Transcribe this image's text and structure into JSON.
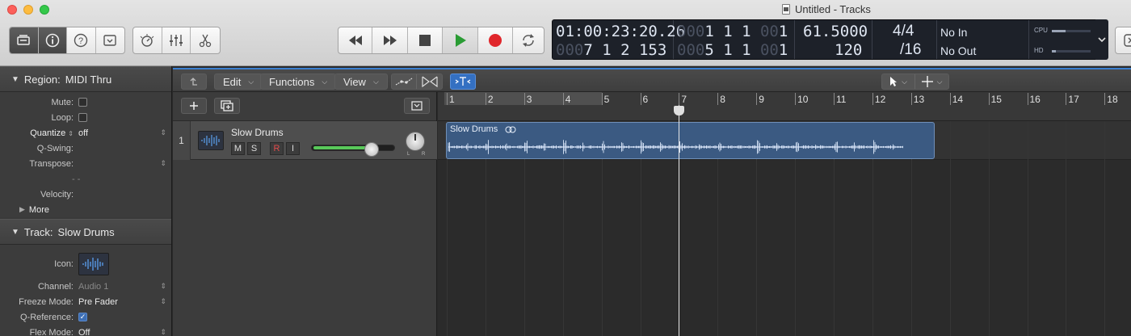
{
  "window": {
    "title": "Untitled - Tracks"
  },
  "lcd": {
    "smpte": "01:00:23:20.26",
    "bars_top_dim": "000",
    "bars_top": "1  1  1  ",
    "bars_top_dim2": "00",
    "bars_top_end": "1",
    "bars_pos_dim": "000",
    "bars_pos": "7  1  2  153",
    "bars_pos2_dim": "000",
    "bars_pos2": "5  1  1  ",
    "bars_pos2_dim2": "00",
    "bars_pos2_end": "1",
    "tempo_top": "61.5000",
    "tempo": "120",
    "sig_top": "4/4",
    "sig": "/16",
    "midi_in": "No In",
    "midi_out": "No Out",
    "cpu_label": "CPU",
    "hd_label": "HD",
    "cpu_level": 0.35,
    "hd_level": 0.1
  },
  "transport": {
    "rewind": "rewind",
    "forward": "fast-forward",
    "stop": "stop",
    "play": "play",
    "record": "record",
    "cycle": "cycle"
  },
  "inspector": {
    "region_header": "Region:",
    "region_name": "MIDI Thru",
    "rows": [
      {
        "key": "Mute:",
        "value": "",
        "type": "check"
      },
      {
        "key": "Loop:",
        "value": "",
        "type": "check"
      },
      {
        "key": "Quantize",
        "value": "off",
        "type": "select"
      },
      {
        "key": "Q-Swing:",
        "value": "",
        "type": "text"
      },
      {
        "key": "Transpose:",
        "value": "",
        "type": "text"
      },
      {
        "key": "",
        "value": "- -",
        "type": "text"
      },
      {
        "key": "Velocity:",
        "value": "",
        "type": "text"
      }
    ],
    "more_label": "More",
    "track_header": "Track:",
    "track_name": "Slow Drums",
    "icon_label": "Icon:",
    "track_rows": [
      {
        "key": "Channel:",
        "value": "Audio 1",
        "type": "muted"
      },
      {
        "key": "Freeze Mode:",
        "value": "Pre Fader",
        "type": "select"
      },
      {
        "key": "Q-Reference:",
        "value": "✓",
        "type": "checked"
      },
      {
        "key": "Flex Mode:",
        "value": "Off",
        "type": "select"
      }
    ]
  },
  "toolbar": {
    "edit": "Edit",
    "functions": "Functions",
    "view": "View"
  },
  "track": {
    "number": "1",
    "name": "Slow Drums",
    "mute": "M",
    "solo": "S",
    "record": "R",
    "input": "I",
    "pan_l": "L",
    "pan_r": "R",
    "volume_level": 0.72
  },
  "ruler": {
    "bars": [
      "1",
      "2",
      "3",
      "4",
      "5",
      "6",
      "7",
      "8",
      "9",
      "10",
      "11",
      "12",
      "13",
      "14",
      "15",
      "16",
      "17",
      "18"
    ]
  },
  "region": {
    "name": "Slow Drums",
    "start_bar": 1,
    "end_bar": 13.6
  },
  "playhead": {
    "bar": 7
  }
}
